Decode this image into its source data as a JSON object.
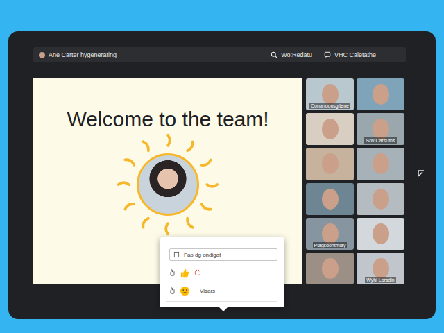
{
  "topbar": {
    "meeting": "Ane Carter hygenerating",
    "search": "Wo:Redatu",
    "chat": "VHC Caletathe"
  },
  "slide": {
    "title": "Welcome to the team!"
  },
  "participants": [
    {
      "name": "Conanuonsgitene"
    },
    {
      "name": ""
    },
    {
      "name": ""
    },
    {
      "name": "Sov Carsuths"
    },
    {
      "name": ""
    },
    {
      "name": ""
    },
    {
      "name": ""
    },
    {
      "name": ""
    },
    {
      "name": "Plagsdontmiay"
    },
    {
      "name": ""
    },
    {
      "name": ""
    },
    {
      "name": "Wyhi Lorsdin"
    }
  ],
  "reactions": {
    "placeholder": "Fao dg ondigat",
    "rows": [
      {
        "kind": "thumbs",
        "label": ""
      },
      {
        "kind": "confused",
        "label": "Visars"
      }
    ]
  }
}
